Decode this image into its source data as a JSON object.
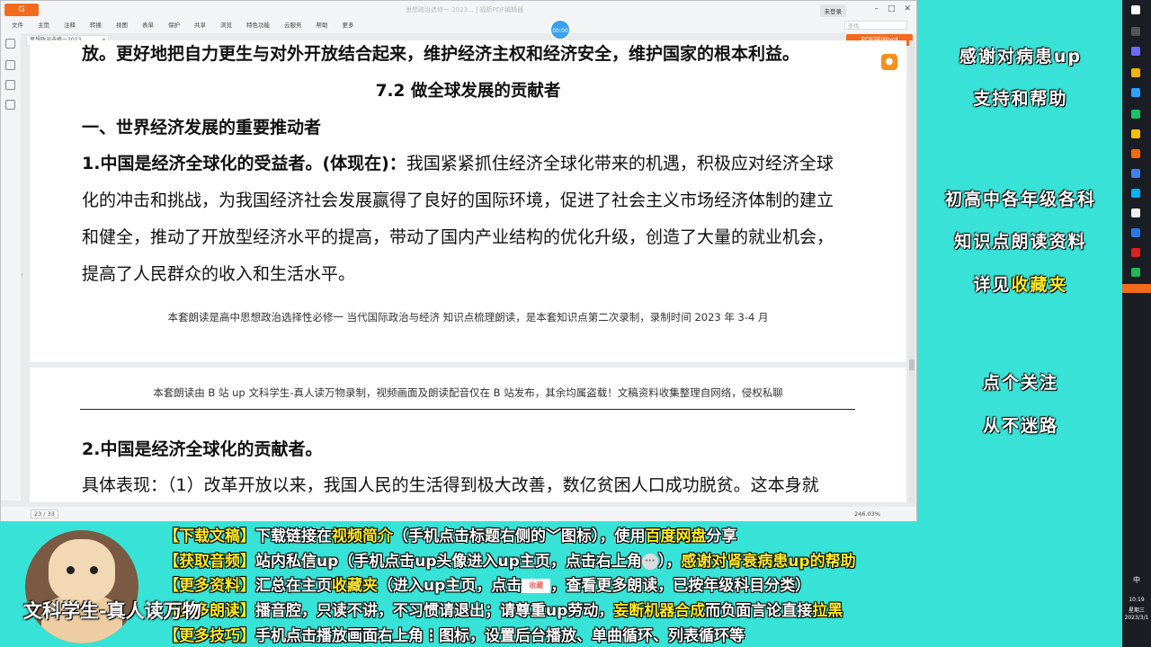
{
  "app": {
    "logo": "G",
    "window_title": "思想政治选修一 2023... | 福昕PDF编辑器",
    "menu": [
      "文件",
      "主页",
      "注释",
      "转换",
      "视图",
      "表单",
      "保护",
      "共享",
      "浏览",
      "特色功能",
      "云服务",
      "帮助",
      "更多"
    ],
    "login_button": "未登录",
    "search_placeholder": "查找",
    "record_badge": "00:00",
    "doc_tab": "思想政治选修一2023...",
    "pdf_to_word": "PDF转Word",
    "page_indicator": "23 / 33",
    "zoom": "246.03%"
  },
  "page1": {
    "top_line": "放。更好地把自力更生与对外开放结合起来，维护经济主权和经济安全，维护国家的根本利益。",
    "section_title": "7.2  做全球发展的贡献者",
    "heading1": "一、世界经济发展的重要推动者",
    "para1_bold": "1.中国是经济全球化的受益者。(体现在)：",
    "para1_line1": "我国紧紧抓住经济全球化带来的机遇，积极应对经济全球",
    "para1_line2": "化的冲击和挑战，为我国经济社会发展赢得了良好的国际环境，促进了社会主义市场经济体制的建立",
    "para1_line3": "和健全，推动了开放型经济水平的提高，带动了国内产业结构的优化升级，创造了大量的就业机会，",
    "para1_line4": "提高了人民群众的收入和生活水平。",
    "footer_note": "本套朗读是高中思想政治选择性必修一  当代国际政治与经济  知识点梳理朗读，是本套知识点第二次录制，录制时间 2023 年 3-4 月"
  },
  "page2": {
    "header_note": "本套朗读由 B 站 up 文科学生-真人读万物录制，视频画面及朗读配音仅在 B 站发布，其余均属盗载！文稿资料收集整理自网络，侵权私聊",
    "heading2": "2.中国是经济全球化的贡献者。",
    "para2": "具体表现：（1）改革开放以来，我国人民的生活得到极大改善，数亿贫困人口成功脱贫。这本身就"
  },
  "right_panel": {
    "line1": "感谢对病患up",
    "line2": "支持和帮助",
    "line3": "初高中各年级各科",
    "line4": "知识点朗读资料",
    "line5a": "详见",
    "line5b": "收藏夹",
    "line6": "点个关注",
    "line7": "从不迷路"
  },
  "banner": {
    "l1_tag": "【下载文稿】",
    "l1_a": "下载链接在",
    "l1_hl1": "视频简介",
    "l1_b": "（手机点击标题右侧的",
    "l1_c": "图标），使用",
    "l1_hl2": "百度网盘",
    "l1_d": "分享",
    "l2_tag": "【获取音频】",
    "l2_a": "站内私信up（手机点击up头像进入up主页，点击右上角",
    "l2_b": "），",
    "l2_hl": "感谢对肾衰病患up的帮助",
    "l3_tag": "【更多资料】",
    "l3_a": "汇总在主页",
    "l3_hl": "收藏夹",
    "l3_b": "（进入up主页，点击",
    "l3_badge": "收藏",
    "l3_c": "，查看更多朗读，已按年级科目分类）",
    "l4_tag": "【更多朗读】",
    "l4_a": "播音腔，只读不讲，不习惯请退出；请尊重up劳动，",
    "l4_hl1": "妄断机器合成",
    "l4_b": "而负面言论直接",
    "l4_hl2": "拉黑",
    "l5_tag": "【更多技巧】",
    "l5_a": "手机点击播放画面右上角",
    "l5_b": "图标，设置后台播放、单曲循环、列表循环等",
    "channel_name": "文科学生-真人读万物"
  },
  "taskbar": {
    "time": "10:19",
    "weekday": "星期三",
    "date": "2023/3/1",
    "ime": "中"
  }
}
